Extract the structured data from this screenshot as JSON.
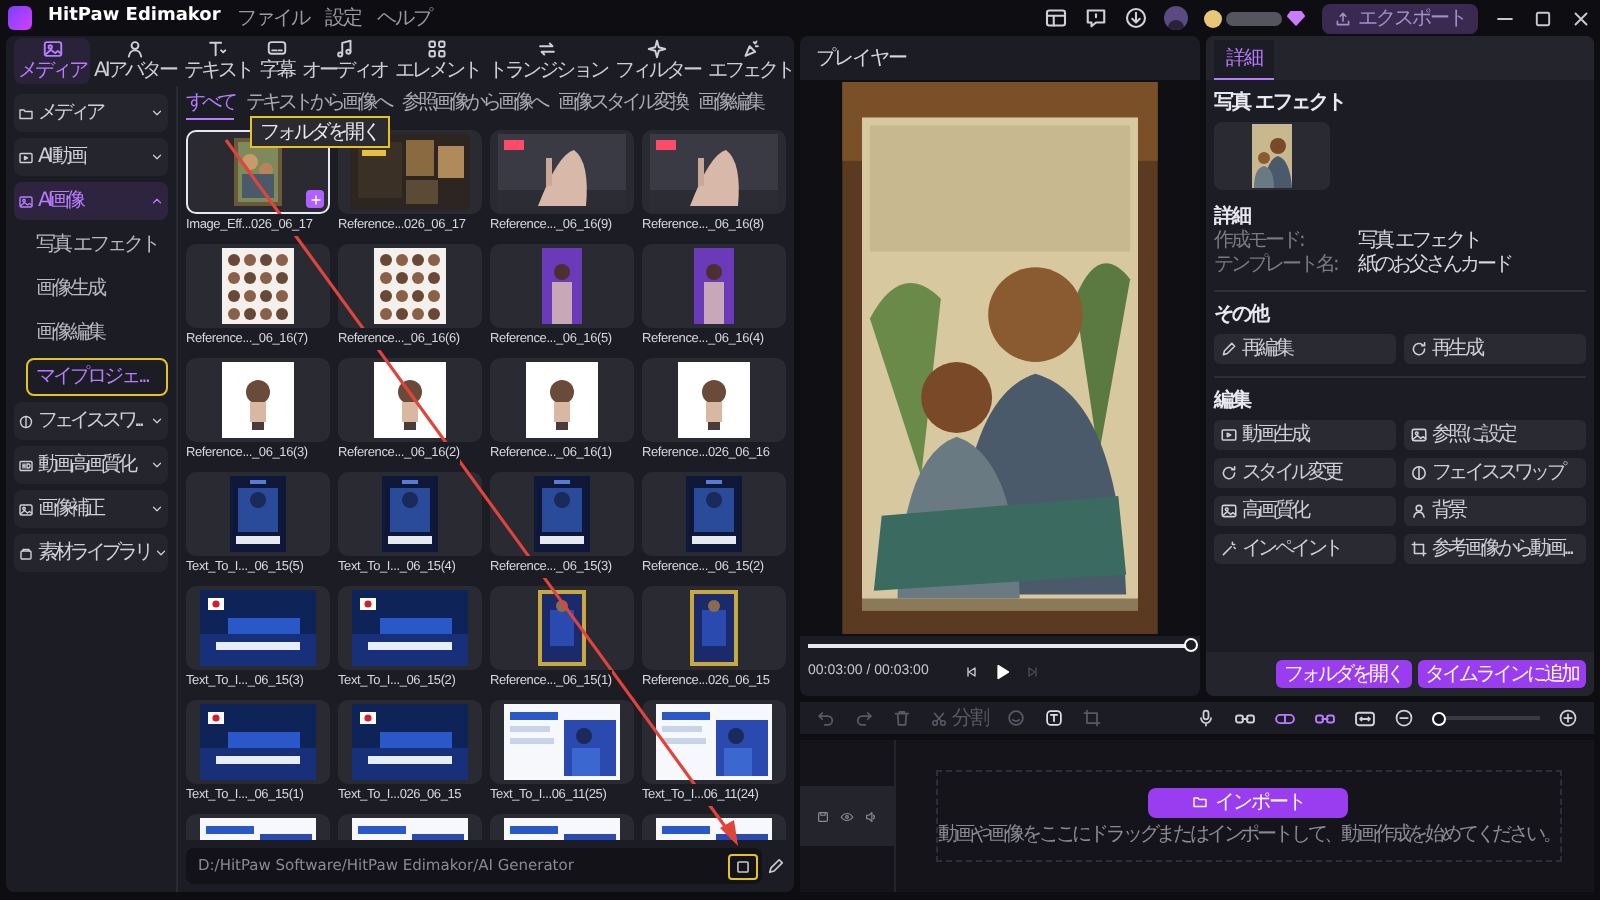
{
  "app": {
    "title": "HitPaw Edimakor",
    "menu": [
      "ファイル",
      "設定",
      "ヘルプ"
    ],
    "export_button": "エクスポート"
  },
  "toolbar": [
    {
      "label": "メディア",
      "selected": true
    },
    {
      "label": "AIアバター",
      "selected": false
    },
    {
      "label": "テキスト",
      "selected": false
    },
    {
      "label": "字幕",
      "selected": false
    },
    {
      "label": "オーディオ",
      "selected": false
    },
    {
      "label": "エレメント",
      "selected": false
    },
    {
      "label": "トランジション",
      "selected": false
    },
    {
      "label": "フィルター",
      "selected": false
    },
    {
      "label": "エフェクト",
      "selected": false
    }
  ],
  "sidebar": [
    {
      "label": "メディア",
      "selected": false,
      "expanded": false
    },
    {
      "label": "AI 動画",
      "selected": false,
      "expanded": false
    },
    {
      "label": "AI画像",
      "selected": true,
      "expanded": true,
      "children": [
        {
          "label": "写真 エフェクト",
          "selected": false
        },
        {
          "label": "画像生成",
          "selected": false
        },
        {
          "label": "画像編集",
          "selected": false
        },
        {
          "label": "マイプロジェ...",
          "selected": true
        }
      ]
    },
    {
      "label": "フェイススワ...",
      "selected": false,
      "expanded": false
    },
    {
      "label": "動画高画質化",
      "selected": false,
      "expanded": false
    },
    {
      "label": "画像補正",
      "selected": false,
      "expanded": false
    },
    {
      "label": "素材ライブラリ",
      "selected": false,
      "expanded": false
    }
  ],
  "media_tabs": [
    {
      "label": "すべて",
      "selected": true
    },
    {
      "label": "テキストから画像へ",
      "selected": false
    },
    {
      "label": "参照画像から画像へ",
      "selected": false
    },
    {
      "label": "画像スタイル変換",
      "selected": false
    },
    {
      "label": "画像編集",
      "selected": false
    }
  ],
  "tooltip": "フォルダを開く",
  "media_items": [
    {
      "label": "Image_Eff...026_06_17",
      "selected": true
    },
    {
      "label": "Reference...026_06_17",
      "selected": false
    },
    {
      "label": "Reference..._06_16(9)",
      "selected": false
    },
    {
      "label": "Reference..._06_16(8)",
      "selected": false
    },
    {
      "label": "Reference..._06_16(7)",
      "selected": false
    },
    {
      "label": "Reference..._06_16(6)",
      "selected": false
    },
    {
      "label": "Reference..._06_16(5)",
      "selected": false
    },
    {
      "label": "Reference..._06_16(4)",
      "selected": false
    },
    {
      "label": "Reference..._06_16(3)",
      "selected": false
    },
    {
      "label": "Reference..._06_16(2)",
      "selected": false
    },
    {
      "label": "Reference..._06_16(1)",
      "selected": false
    },
    {
      "label": "Reference...026_06_16",
      "selected": false
    },
    {
      "label": "Text_To_I..._06_15(5)",
      "selected": false
    },
    {
      "label": "Text_To_I..._06_15(4)",
      "selected": false
    },
    {
      "label": "Reference..._06_15(3)",
      "selected": false
    },
    {
      "label": "Reference..._06_15(2)",
      "selected": false
    },
    {
      "label": "Text_To_I..._06_15(3)",
      "selected": false
    },
    {
      "label": "Text_To_I..._06_15(2)",
      "selected": false
    },
    {
      "label": "Reference..._06_15(1)",
      "selected": false
    },
    {
      "label": "Reference...026_06_15",
      "selected": false
    },
    {
      "label": "Text_To_I..._06_15(1)",
      "selected": false
    },
    {
      "label": "Text_To_I...026_06_15",
      "selected": false
    },
    {
      "label": "Text_To_I...06_11(25)",
      "selected": false
    },
    {
      "label": "Text_To_I...06_11(24)",
      "selected": false
    },
    {
      "selected": false
    },
    {
      "selected": false
    },
    {
      "selected": false
    },
    {
      "selected": false
    }
  ],
  "path_bar": {
    "value": "D:/HitPaw Software/HitPaw Edimakor/AI Generator",
    "folder_highlighted": true
  },
  "player": {
    "title": "プレイヤー",
    "level": 1,
    "time": "00:03:00 / 00:03:00"
  },
  "details": {
    "tab": "詳細",
    "section_title": "写真 エフェクト",
    "info_title": "詳細",
    "info": [
      {
        "label": "作成モード:",
        "value": "写真 エフェクト"
      },
      {
        "label": "テンプレート名:",
        "value": "紙のお父さんカード"
      }
    ],
    "other_title": "その他",
    "other_buttons": [
      "再編集",
      "再生成"
    ],
    "edit_title": "編集",
    "edit_buttons": [
      "動画生成",
      "参照に設定",
      "スタイル変更",
      "フェイススワップ",
      "高画質化",
      "背景",
      "インペイント",
      "参考画像から動画..."
    ],
    "footer_buttons": [
      "フォルダを開く",
      "タイムラインに追加"
    ]
  },
  "timeline": {
    "split_label": "分割",
    "zoom": {
      "level": 0
    },
    "import_button": "インポート",
    "hint": "動画や画像をここにドラッグまたはインポートして、動画作成を始めてください。"
  }
}
